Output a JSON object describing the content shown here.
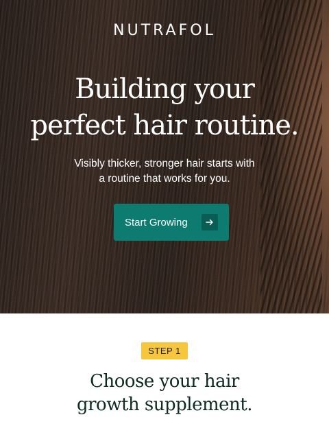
{
  "hero": {
    "logo": "NUTRAFOL",
    "headline_line1": "Building your",
    "headline_line2": "perfect hair routine.",
    "subtext_line1": "Visibly thicker, stronger hair starts with",
    "subtext_line2": "a routine that works for you.",
    "cta_label": "Start Growing",
    "cta_icon": "arrow-right-icon"
  },
  "step": {
    "badge": "STEP 1",
    "title_line1": "Choose your hair",
    "title_line2": "growth supplement."
  },
  "colors": {
    "cta_bg": "#0d7b70",
    "badge_bg": "#f6c63c",
    "title_text": "#0f2a22"
  }
}
